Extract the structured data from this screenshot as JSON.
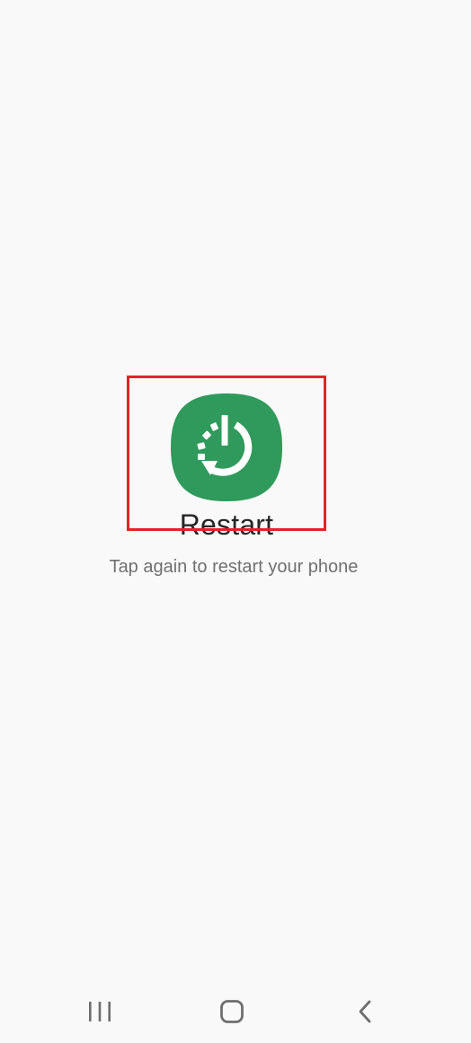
{
  "restart": {
    "label": "Restart",
    "icon": "restart-icon",
    "icon_color": "#2f9a5b"
  },
  "hint": {
    "text": "Tap again to restart your phone"
  },
  "highlight_color": "#e8202a",
  "navigation": {
    "recent_icon": "recent-apps-icon",
    "home_icon": "home-icon",
    "back_icon": "back-icon"
  }
}
